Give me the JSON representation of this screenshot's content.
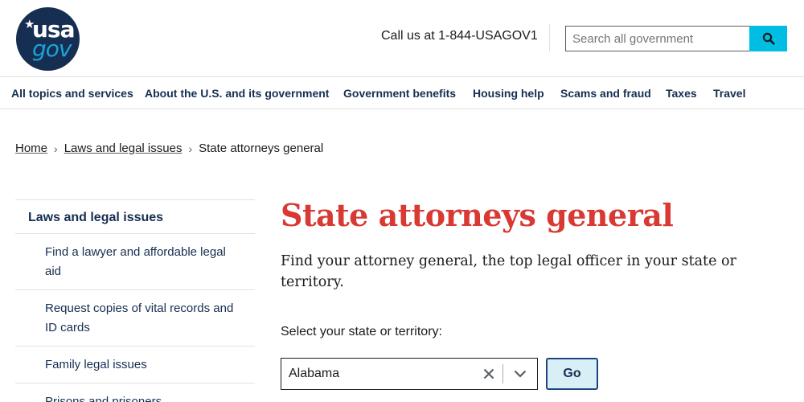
{
  "header": {
    "logo_top": "usa",
    "logo_bottom": "gov",
    "call_text": "Call us at 1-844-USAGOV1",
    "search_placeholder": "Search all government",
    "search_icon": "magnifier-icon"
  },
  "nav": {
    "items": [
      "All topics and services",
      "About the U.S. and its government",
      "Government benefits",
      "Housing help",
      "Scams and fraud",
      "Taxes",
      "Travel"
    ]
  },
  "breadcrumb": {
    "home": "Home",
    "section": "Laws and legal issues",
    "current": "State attorneys general"
  },
  "sidebar": {
    "heading": "Laws and legal issues",
    "items": [
      "Find a lawyer and affordable legal aid",
      "Request copies of vital records and ID cards",
      "Family legal issues",
      "Prisons and prisoners"
    ]
  },
  "main": {
    "title": "State attorneys general",
    "lead": "Find your attorney general, the top legal officer in your state or territory.",
    "select_label": "Select your state or territory:",
    "selected_value": "Alabama",
    "go_label": "Go"
  },
  "colors": {
    "title_red": "#d83933",
    "nav_navy": "#162e51",
    "search_button": "#00bde3",
    "go_button_bg": "#d9eff6"
  }
}
